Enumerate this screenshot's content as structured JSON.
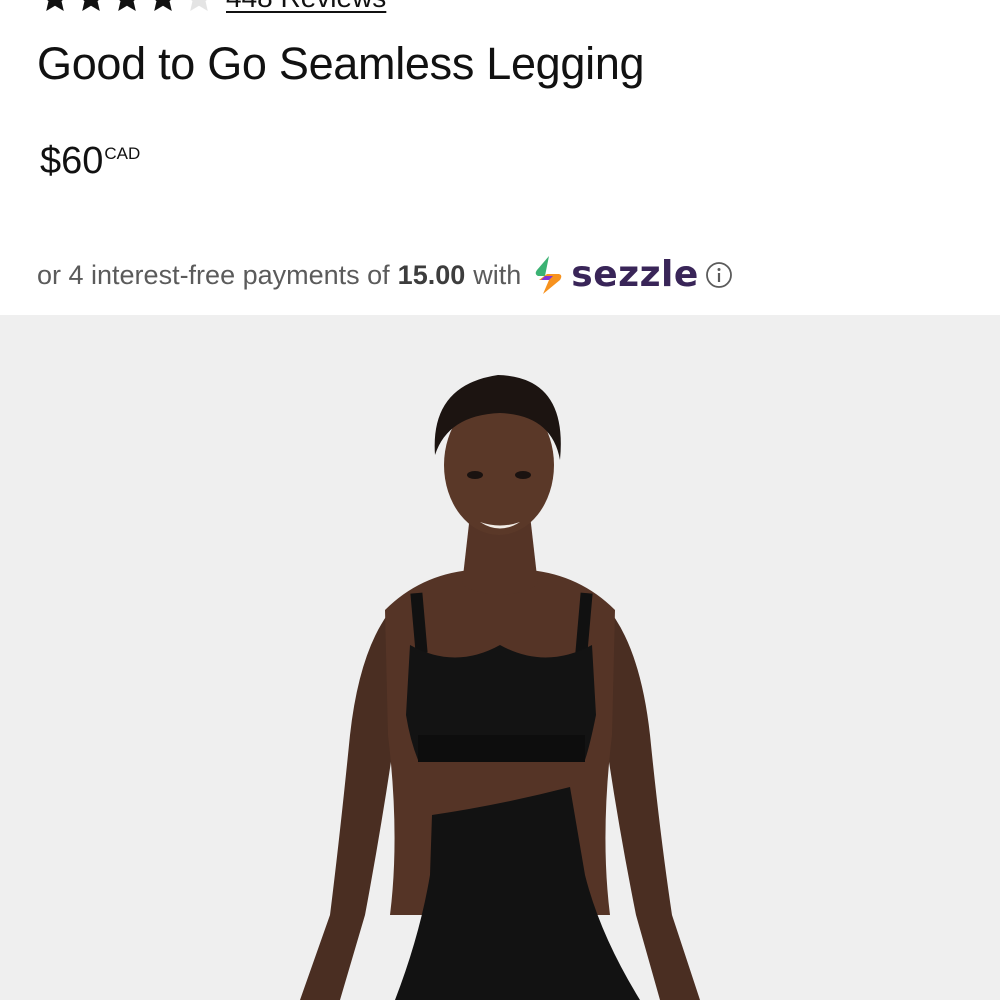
{
  "product": {
    "rating": {
      "stars_filled": 4,
      "stars_total": 5,
      "reviews_label": "448 Reviews"
    },
    "title": "Good to Go Seamless Legging",
    "price": {
      "amount": "$60",
      "currency": "CAD"
    },
    "installments": {
      "prefix": "or 4 interest-free payments of",
      "amount": "15.00",
      "with": "with",
      "provider": "sezzle",
      "info_icon": "info-circle-icon"
    },
    "image": {
      "background": "#efefef"
    }
  },
  "colors": {
    "text": "#111111",
    "muted_text": "#5b5b5b",
    "sezzle_purple": "#392558",
    "sezzle_orange": "#f7921e",
    "sezzle_green": "#3bb273",
    "sezzle_violet": "#8333d4"
  }
}
